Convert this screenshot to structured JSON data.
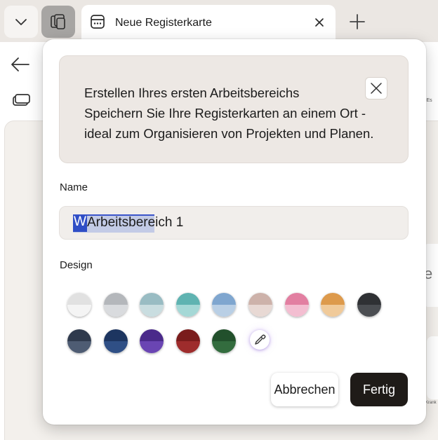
{
  "browser": {
    "tab": {
      "title": "Neue Registerkarte"
    }
  },
  "workspace_dialog": {
    "banner": {
      "line1": "Erstellen Ihres ersten Arbeitsbereichs",
      "line2": "Speichern Sie Ihre Registerkarten an einem Ort -",
      "line3": "ideal zum Organisieren von Projekten und Planen."
    },
    "name_label": "Name",
    "name_value": "Arbeitsbereich 1",
    "name_cursor_char": "W",
    "design_label": "Design",
    "swatches": [
      {
        "top": "#e1e1e1",
        "bottom": "#f4f4f4"
      },
      {
        "top": "#b4b7bb",
        "bottom": "#d9dbde"
      },
      {
        "top": "#99bcc3",
        "bottom": "#c9dde0"
      },
      {
        "top": "#5fb3b1",
        "bottom": "#a5d8d6"
      },
      {
        "top": "#7fa6cf",
        "bottom": "#b9cfe5"
      },
      {
        "top": "#cdb2aa",
        "bottom": "#e8d9d4"
      },
      {
        "top": "#e27fa1",
        "bottom": "#f3bed1"
      },
      {
        "top": "#dd9a4c",
        "bottom": "#f0ca9a"
      },
      {
        "top": "#2f3134",
        "bottom": "#4b4e52"
      },
      {
        "top": "#2f3a4d",
        "bottom": "#4e5c73"
      },
      {
        "top": "#1d3560",
        "bottom": "#2f4f85"
      },
      {
        "top": "#4a2a8a",
        "bottom": "#6a45b3"
      },
      {
        "top": "#7a1c1c",
        "bottom": "#9e2c2c"
      },
      {
        "top": "#22502c",
        "bottom": "#336c3e"
      }
    ],
    "cancel_label": "Abbrechen",
    "done_label": "Fertig"
  },
  "background": {
    "strip_text": "•Es",
    "card_glyph": "e",
    "tiny_text": "Krank"
  }
}
